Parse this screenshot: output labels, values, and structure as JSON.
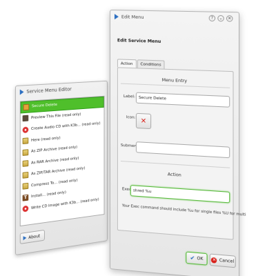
{
  "service_menu_editor": {
    "title": "Service Menu Editor",
    "items": [
      {
        "label": "Secure Delete",
        "icon": "secure-delete-icon",
        "selected": true
      },
      {
        "label": "Preview This File (read only)",
        "icon": "preview-icon"
      },
      {
        "label": "Create Audio CD with K3b... (read only)",
        "icon": "cd-icon"
      },
      {
        "label": "Here (read only)",
        "icon": "archive-icon"
      },
      {
        "label": "As ZIP Archive (read only)",
        "icon": "archive-icon"
      },
      {
        "label": "As RAR Archive (read only)",
        "icon": "archive-icon"
      },
      {
        "label": "As ZIP/TAR Archive (read only)",
        "icon": "archive-icon"
      },
      {
        "label": "Compress To... (read only)",
        "icon": "archive-icon"
      },
      {
        "label": "Install... (read only)",
        "icon": "install-icon"
      },
      {
        "label": "Write CD Image with K3b... (read only)",
        "icon": "cd-icon"
      }
    ],
    "about_label": "About"
  },
  "edit_menu": {
    "title": "Edit Menu",
    "heading": "Edit Service Menu",
    "tabs": [
      {
        "label": "Action",
        "active": true
      },
      {
        "label": "Conditions",
        "active": false
      }
    ],
    "menu_entry": {
      "group_title": "Menu Entry",
      "label_caption": "Label:",
      "label_value": "Secure Delete",
      "icon_caption": "Icon:",
      "submenu_caption": "Submenu:",
      "submenu_value": ""
    },
    "action": {
      "group_title": "Action",
      "exec_caption": "Exec:",
      "exec_value": "shred %u",
      "hint": "Your Exec command should include %u for single files %U for multi"
    },
    "ok_label": "OK",
    "cancel_label": "Cancel"
  },
  "colors": {
    "selection": "#4fbf2b",
    "focus": "#56b83a",
    "kde_blue": "#2c6fc1",
    "icon_red": "#d8211b"
  }
}
